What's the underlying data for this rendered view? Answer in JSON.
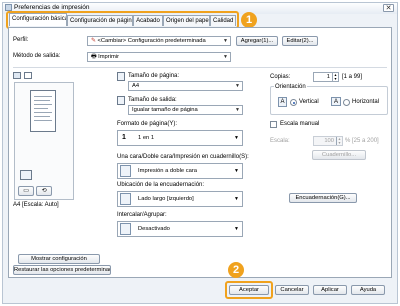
{
  "window": {
    "title": "Preferencias de impresión",
    "close_glyph": "✕"
  },
  "tabs": [
    {
      "label": "Configuración básica"
    },
    {
      "label": "Configuración de página"
    },
    {
      "label": "Acabado"
    },
    {
      "label": "Origen del papel"
    },
    {
      "label": "Calidad"
    }
  ],
  "badges": {
    "one": "1",
    "two": "2"
  },
  "profile": {
    "label": "Perfil:",
    "value": "<Cambiar> Configuración predeterminada",
    "add_label": "Agregar(1)...",
    "edit_label": "Editar(2)..."
  },
  "output": {
    "label": "Método de salida:",
    "value": "Imprimir"
  },
  "preview": {
    "caption": "A4 [Escala: Auto]",
    "view_buttons": [
      "▭",
      "⟲"
    ]
  },
  "page_size": {
    "label": "Tamaño de página:",
    "value": "A4"
  },
  "output_size": {
    "label": "Tamaño de salida:",
    "value": "Igualar tamaño de página"
  },
  "copies": {
    "label": "Copias:",
    "value": "1",
    "range": "[1 a 99]"
  },
  "orientation": {
    "label": "Orientación",
    "vertical_label": "Vertical",
    "horizontal_label": "Horizontal",
    "selected": "Vertical"
  },
  "page_format": {
    "label": "Formato de página(Y):",
    "value": "1 en 1",
    "number": "1"
  },
  "manual_scale": {
    "label": "Escala manual",
    "scale_label": "Escala:",
    "scale_value": "100",
    "scale_range": "% [25 a 200]"
  },
  "duplex": {
    "label": "Una cara/Doble cara/Impresión en cuadernillo(S):",
    "value": "Impresión a doble cara",
    "booklet_button": "Cuadernillo..."
  },
  "binding": {
    "label": "Ubicación de la encuadernación:",
    "value": "Lado largo [izquierdo]",
    "margin_button": "Encuadernación(G)..."
  },
  "collate": {
    "label": "Intercalar/Agrupar:",
    "value": "Desactivado"
  },
  "left_buttons": {
    "show_settings": "Mostrar configuración",
    "restore_defaults": "Restaurar las opciones predeterminadas"
  },
  "footer": {
    "ok": "Aceptar",
    "cancel": "Cancelar",
    "apply": "Aplicar",
    "help": "Ayuda"
  },
  "colors": {
    "highlight": "#f0a21e",
    "panel_border": "#9aa7b6"
  }
}
